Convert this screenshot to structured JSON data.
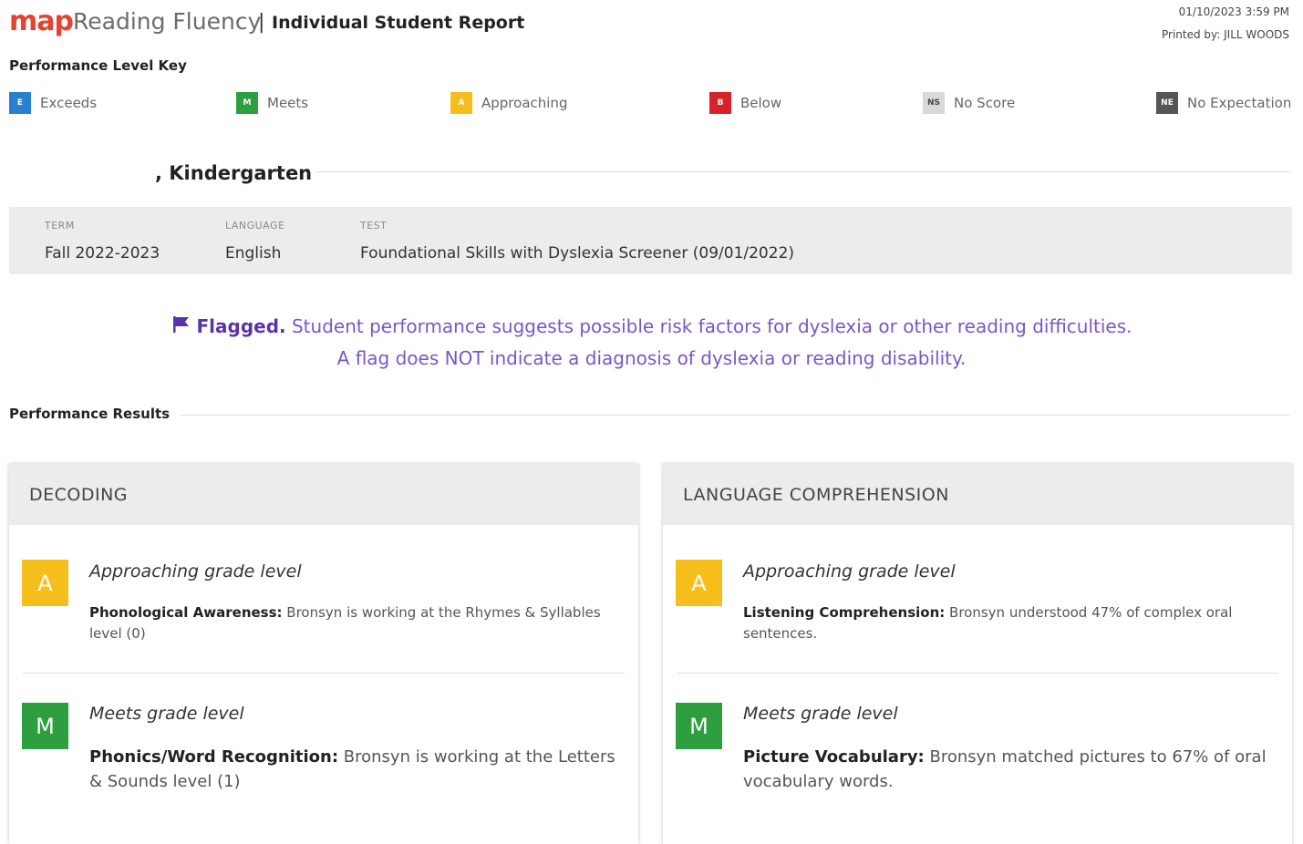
{
  "header": {
    "logo_map": "map",
    "logo_product": "Reading Fluency",
    "separator": "|",
    "report_title": "Individual Student Report",
    "timestamp": "01/10/2023 3:59 PM",
    "printed_by": "Printed by: JILL WOODS"
  },
  "key": {
    "title": "Performance Level Key",
    "items": [
      {
        "abbr": "E",
        "label": "Exceeds",
        "color": "#2b7fd0",
        "icon": "exceeds-square"
      },
      {
        "abbr": "M",
        "label": "Meets",
        "color": "#2e9f3e",
        "icon": "meets-square"
      },
      {
        "abbr": "A",
        "label": "Approaching",
        "color": "#f6be1a",
        "icon": "approaching-square"
      },
      {
        "abbr": "B",
        "label": "Below",
        "color": "#d7222a",
        "icon": "below-square"
      },
      {
        "abbr": "NS",
        "label": "No Score",
        "color": "#d9d9d9",
        "icon": "no-score-square"
      },
      {
        "abbr": "NE",
        "label": "No Expectation",
        "color": "#555555",
        "icon": "no-expectation-square"
      }
    ]
  },
  "student": {
    "grade_line": ", Kindergarten"
  },
  "meta": {
    "term_label": "TERM",
    "term_value": "Fall 2022-2023",
    "language_label": "LANGUAGE",
    "language_value": "English",
    "test_label": "TEST",
    "test_value": "Foundational Skills with Dyslexia Screener (09/01/2022)"
  },
  "flag": {
    "icon": "flag-icon",
    "bold": "Flagged.",
    "line1": " Student performance suggests possible risk factors for dyslexia or other reading difficulties.",
    "line2": "A flag does NOT indicate a diagnosis of dyslexia or reading disability."
  },
  "results": {
    "title": "Performance Results",
    "cards": [
      {
        "title": "DECODING",
        "entries": [
          {
            "badge": "A",
            "level": "Approaching grade level",
            "skill": "Phonological Awareness:",
            "text": " Bronsyn is working at the Rhymes & Syllables level (0)"
          },
          {
            "badge": "M",
            "level": "Meets grade level",
            "skill": "Phonics/Word Recognition:",
            "text": " Bronsyn is working at the Letters & Sounds level (1)"
          }
        ]
      },
      {
        "title": "LANGUAGE COMPREHENSION",
        "entries": [
          {
            "badge": "A",
            "level": "Approaching grade level",
            "skill": "Listening Comprehension:",
            "text": " Bronsyn understood 47% of complex oral sentences."
          },
          {
            "badge": "M",
            "level": "Meets grade level",
            "skill": "Picture Vocabulary:",
            "text": " Bronsyn matched pictures to 67% of oral vocabulary words."
          }
        ]
      }
    ]
  },
  "colors": {
    "brand": "#e8412e",
    "flag_purple": "#7d55c7",
    "approaching": "#f6be1a",
    "meets": "#2e9f3e"
  }
}
